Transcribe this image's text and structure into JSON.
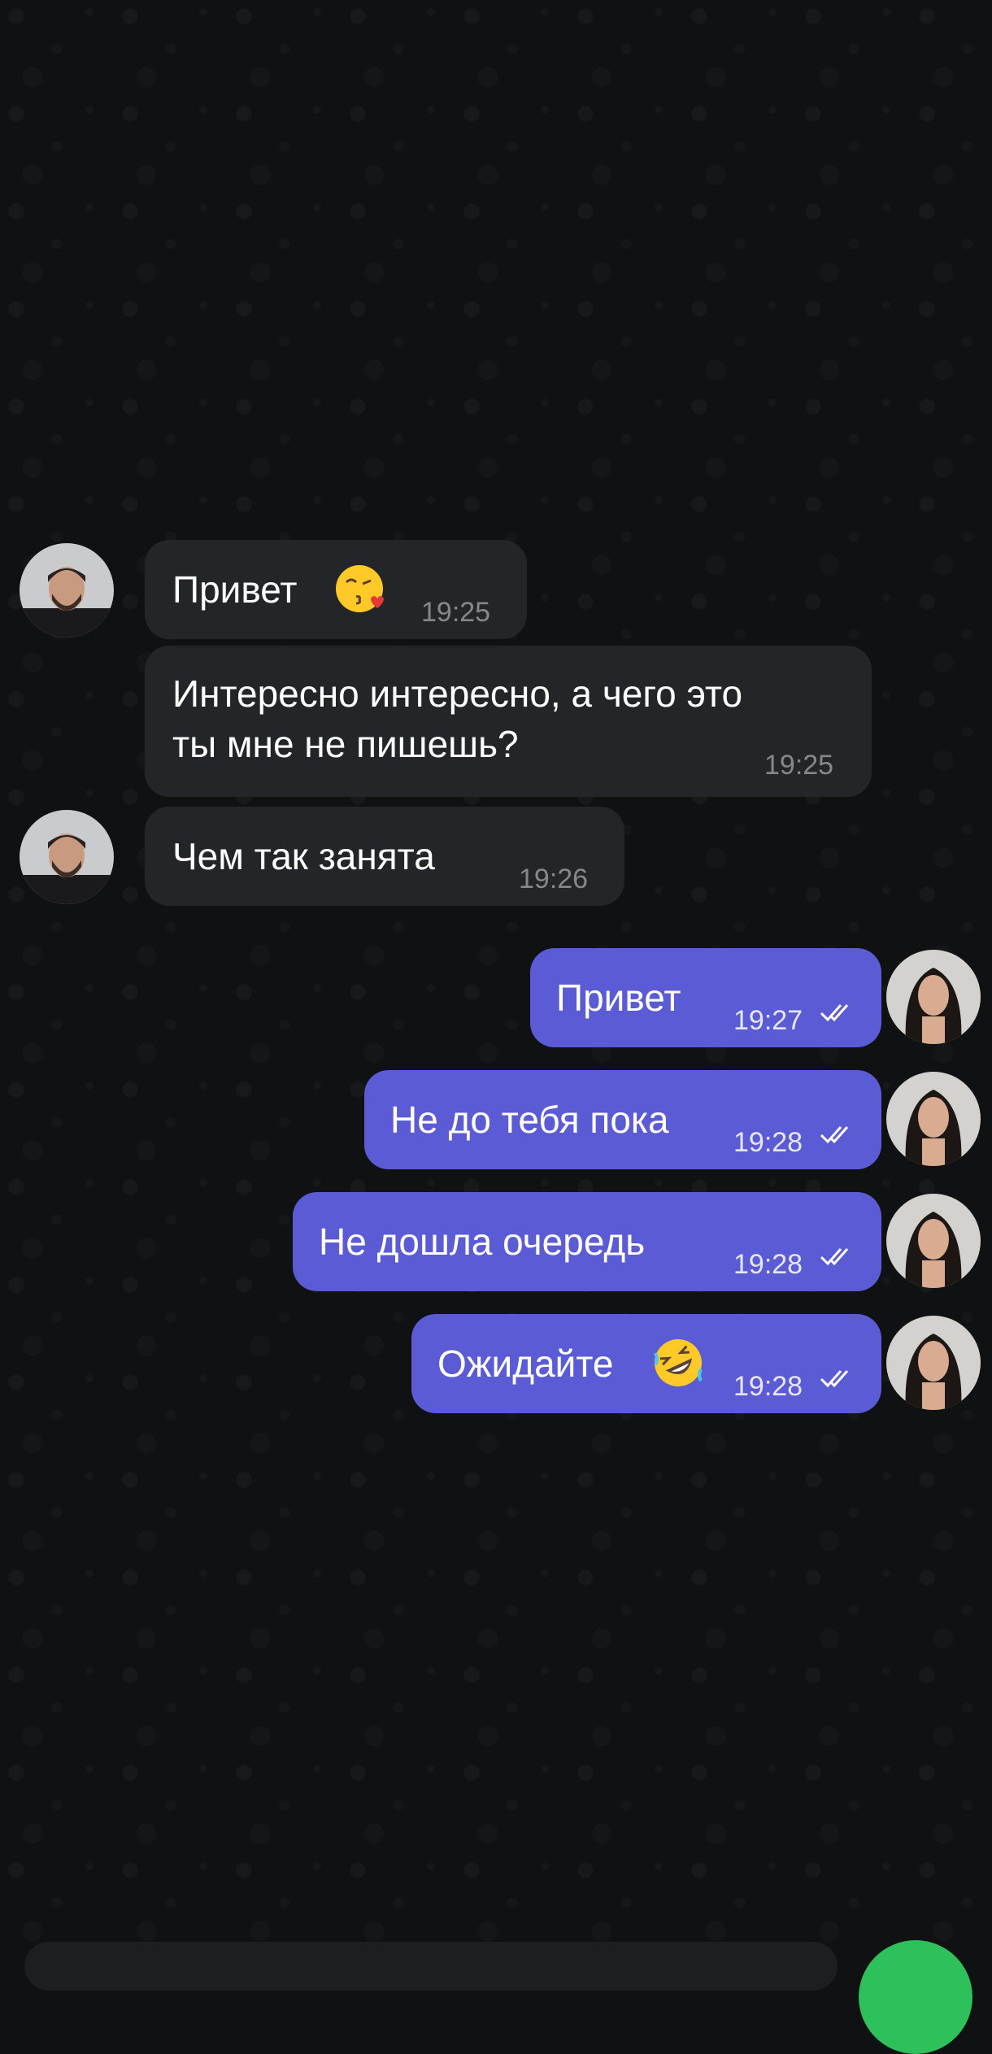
{
  "messages": [
    {
      "side": "in",
      "text": "Привет",
      "time": "19:25",
      "emoji": "kissing-face-heart-emoji",
      "avatar": "man-avatar"
    },
    {
      "side": "in",
      "text": "Интересно интересно, а чего это\nты мне не пишешь?",
      "time": "19:25"
    },
    {
      "side": "in",
      "text": "Чем так занята",
      "time": "19:26",
      "avatar": "man-avatar"
    },
    {
      "side": "out",
      "text": "Привет",
      "time": "19:27",
      "status": "read-double-check-icon",
      "avatar": "woman-avatar"
    },
    {
      "side": "out",
      "text": "Не до тебя пока",
      "time": "19:28",
      "status": "read-double-check-icon",
      "avatar": "woman-avatar"
    },
    {
      "side": "out",
      "text": "Не дошла очередь",
      "time": "19:28",
      "status": "read-double-check-icon",
      "avatar": "woman-avatar"
    },
    {
      "side": "out",
      "text": "Ожидайте",
      "time": "19:28",
      "emoji": "rolling-laughing-emoji",
      "status": "read-double-check-icon",
      "avatar": "woman-avatar"
    }
  ],
  "colors": {
    "background": "#0f1113",
    "incoming_bubble": "#232528",
    "outgoing_bubble": "#5b5bd6",
    "send_button": "#2ec05a"
  }
}
